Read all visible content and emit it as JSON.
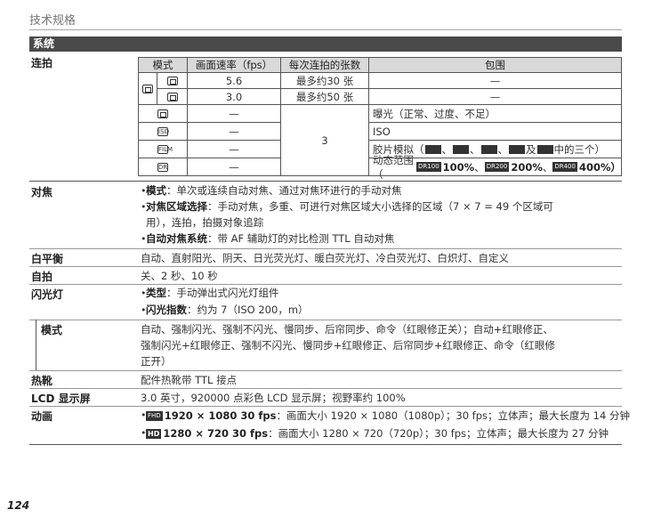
{
  "header": {
    "title": "技术规格"
  },
  "section": {
    "title": "系统"
  },
  "page_number": "124",
  "burst": {
    "label": "连拍",
    "col_mode": "模式",
    "col_fps": "画面速率（fps）",
    "col_shots": "每次连拍的张数",
    "col_bracket": "包围",
    "row1_fps": "5.6",
    "row1_shots": "最多约30 张",
    "row1_bracket": "—",
    "row2_fps": "3.0",
    "row2_shots": "最多约50 张",
    "row2_bracket": "—",
    "dash": "—",
    "shots_bracket": "3",
    "bracket_ae": "曝光（正常、过度、不足）",
    "bracket_iso": "ISO",
    "bracket_film_pre": "胶片模拟（",
    "bracket_film_sep1": "、",
    "bracket_film_sep2": "、",
    "bracket_film_sep3": "、",
    "bracket_film_and": " 及 ",
    "bracket_film_post": " 中的三个）",
    "bracket_dr_pre": "动态范围（",
    "dr_100": "100%",
    "dr_200": "200%",
    "dr_400": "400%）",
    "dr_sep1": "、",
    "dr_sep2": "、",
    "icon_labels": {
      "dr100": "DR100",
      "dr200": "DR200",
      "dr400": "DR400",
      "bkt_iso": "ISO",
      "bkt_film": "FILM",
      "bkt_dr": "DR"
    }
  },
  "focus": {
    "label": "对焦",
    "item1_key": "模式",
    "item1_val": "：单次或连续自动对焦、通过对焦环进行的手动对焦",
    "item2_key": "对焦区域选择",
    "item2_val": "：手动对焦，多重、可进行对焦区域大小选择的区域（7 × 7 = 49 个区域可",
    "item2_cont": "用），连拍，拍摄对象追踪",
    "item3_key": "自动对焦系统",
    "item3_val": "：带 AF 辅助灯的对比检测 TTL 自动对焦"
  },
  "white_balance": {
    "label": "白平衡",
    "value": "自动、直射阳光、阴天、日光荧光灯、暖白荧光灯、冷白荧光灯、白炽灯、自定义"
  },
  "self_timer": {
    "label": "自拍",
    "value": "关、2 秒、10 秒"
  },
  "flash": {
    "label": "闪光灯",
    "type_key": "类型",
    "type_val": "：手动弹出式闪光灯组件",
    "gn_key": "闪光指数",
    "gn_val": "：约为 7（ISO 200，m）",
    "mode_label": "模式",
    "mode_line1": "自动、强制闪光、强制不闪光、慢同步、后帘同步、命令（红眼修正关）；自动+红眼修正、",
    "mode_line2": "强制闪光+红眼修正、强制不闪光、慢同步+红眼修正、后帘同步+红眼修正、命令（红眼修",
    "mode_line3": "正开）"
  },
  "hot_shoe": {
    "label": "热靴",
    "value": "配件热靴带 TTL 接点"
  },
  "lcd": {
    "label": "LCD 显示屏",
    "value": "3.0 英寸，920000 点彩色 LCD 显示屏；视野率约 100%"
  },
  "movie": {
    "label": "动画",
    "fhd_badge": "FHD",
    "fhd_key": "1920 × 1080 30 fps",
    "fhd_val": "：画面大小 1920 × 1080（1080p）；30 fps；立体声；最大长度为 14 分钟",
    "hd_badge": "HD",
    "hd_key": "1280 × 720 30 fps",
    "hd_val": "：画面大小 1280 × 720（720p）；30 fps；立体声；最大长度为 27 分钟"
  },
  "bullet_char": "•"
}
